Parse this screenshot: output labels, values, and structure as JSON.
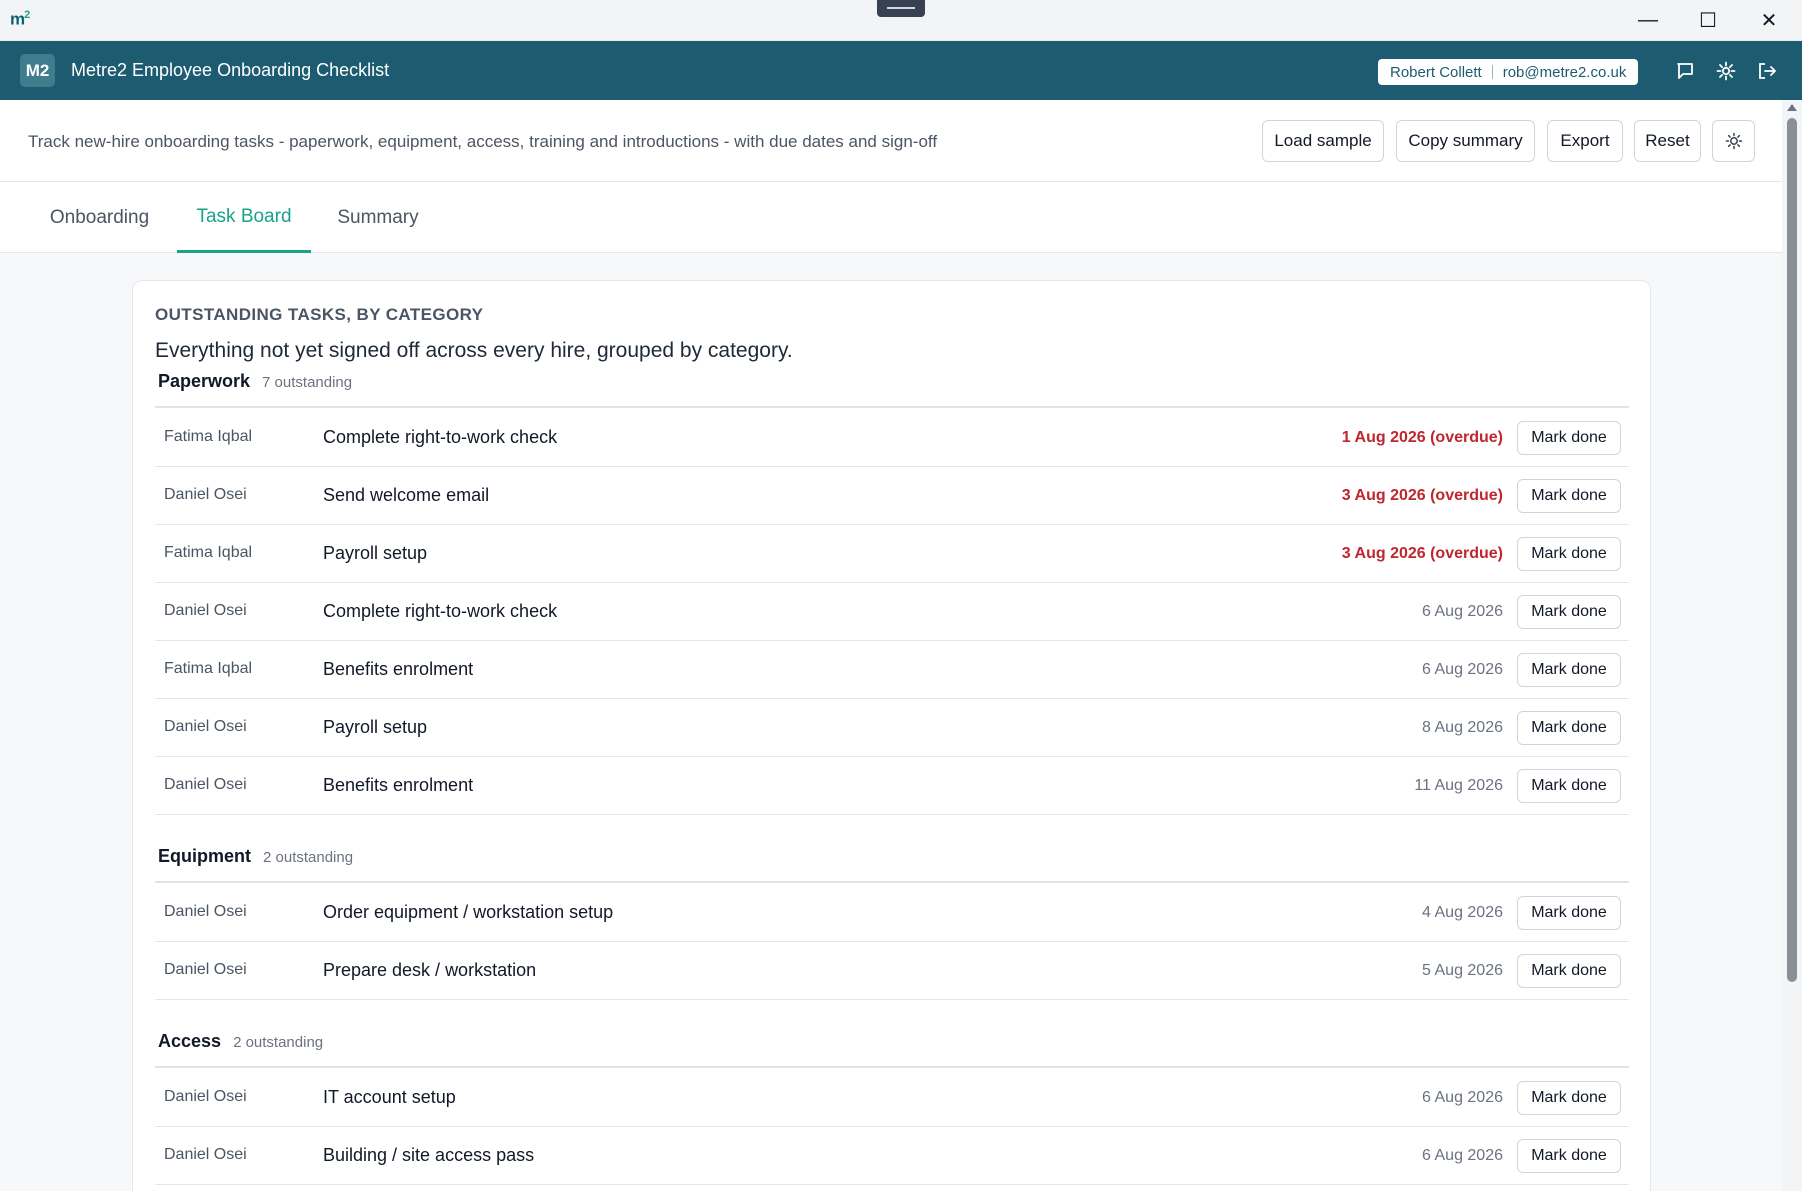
{
  "os": {
    "logo": "m",
    "logo_sup": "2",
    "minimize": "—",
    "maximize": "☐",
    "close": "✕"
  },
  "header": {
    "badge": "M2",
    "title": "Metre2 Employee Onboarding Checklist",
    "user_name": "Robert Collett",
    "user_email": "rob@metre2.co.uk",
    "icons": [
      "chat-icon",
      "gear-icon",
      "logout-icon"
    ]
  },
  "toolbar": {
    "description": "Track new-hire onboarding tasks - paperwork, equipment, access, training and introductions - with due dates and sign-off",
    "load_sample": "Load sample",
    "copy_summary": "Copy summary",
    "export": "Export",
    "reset": "Reset"
  },
  "tabs": [
    {
      "label": "Onboarding"
    },
    {
      "label": "Task Board",
      "active": true
    },
    {
      "label": "Summary"
    }
  ],
  "board": {
    "eyebrow": "OUTSTANDING TASKS, BY CATEGORY",
    "subtitle": "Everything not yet signed off across every hire, grouped by category.",
    "mark_done_label": "Mark done",
    "categories": [
      {
        "name": "Paperwork",
        "count": "7 outstanding",
        "rows": [
          {
            "person": "Fatima Iqbal",
            "task": "Complete right-to-work check",
            "due": "1 Aug 2026 (overdue)",
            "overdue": true
          },
          {
            "person": "Daniel Osei",
            "task": "Send welcome email",
            "due": "3 Aug 2026 (overdue)",
            "overdue": true
          },
          {
            "person": "Fatima Iqbal",
            "task": "Payroll setup",
            "due": "3 Aug 2026 (overdue)",
            "overdue": true
          },
          {
            "person": "Daniel Osei",
            "task": "Complete right-to-work check",
            "due": "6 Aug 2026",
            "overdue": false
          },
          {
            "person": "Fatima Iqbal",
            "task": "Benefits enrolment",
            "due": "6 Aug 2026",
            "overdue": false
          },
          {
            "person": "Daniel Osei",
            "task": "Payroll setup",
            "due": "8 Aug 2026",
            "overdue": false
          },
          {
            "person": "Daniel Osei",
            "task": "Benefits enrolment",
            "due": "11 Aug 2026",
            "overdue": false
          }
        ]
      },
      {
        "name": "Equipment",
        "count": "2 outstanding",
        "rows": [
          {
            "person": "Daniel Osei",
            "task": "Order equipment / workstation setup",
            "due": "4 Aug 2026",
            "overdue": false
          },
          {
            "person": "Daniel Osei",
            "task": "Prepare desk / workstation",
            "due": "5 Aug 2026",
            "overdue": false
          }
        ]
      },
      {
        "name": "Access",
        "count": "2 outstanding",
        "rows": [
          {
            "person": "Daniel Osei",
            "task": "IT account setup",
            "due": "6 Aug 2026",
            "overdue": false
          },
          {
            "person": "Daniel Osei",
            "task": "Building / site access pass",
            "due": "6 Aug 2026",
            "overdue": false
          }
        ]
      }
    ]
  },
  "colors": {
    "header_bg": "#1d5c70",
    "accent": "#1aa38a",
    "overdue": "#c0262d"
  }
}
